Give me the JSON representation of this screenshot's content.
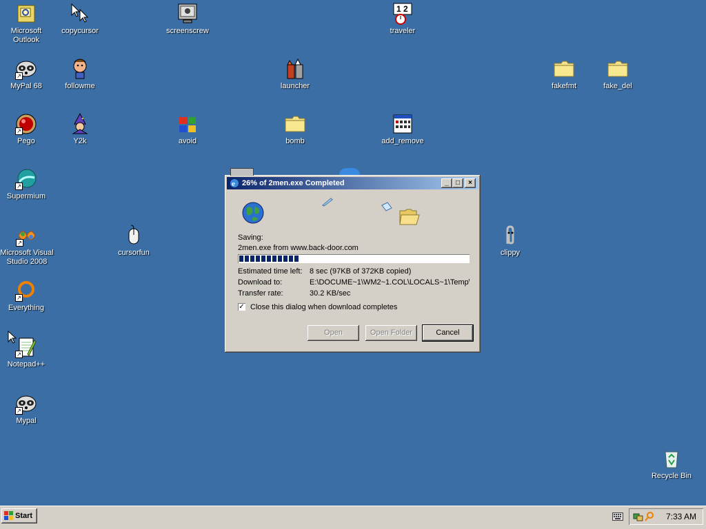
{
  "desktop": {
    "icons": [
      {
        "label": "Microsoft Outlook",
        "icon": "outlook-icon"
      },
      {
        "label": "copycursor",
        "icon": "cursor-icon"
      },
      {
        "label": "screenscrew",
        "icon": "monitor-icon"
      },
      {
        "label": "traveler",
        "icon": "clock-icon"
      },
      {
        "label": "MyPal 68",
        "icon": "raccoon-icon"
      },
      {
        "label": "followme",
        "icon": "character-icon"
      },
      {
        "label": "launcher",
        "icon": "rocket-icon"
      },
      {
        "label": "fakefmt",
        "icon": "folder-icon"
      },
      {
        "label": "fake_del",
        "icon": "folder-icon"
      },
      {
        "label": "Pego",
        "icon": "red-ball-icon"
      },
      {
        "label": "Y2k",
        "icon": "wizard-icon"
      },
      {
        "label": "avoid",
        "icon": "windows-flag-icon"
      },
      {
        "label": "bomb",
        "icon": "folder-icon"
      },
      {
        "label": "add_remove",
        "icon": "calendar-icon"
      },
      {
        "label": "Supermium",
        "icon": "supermium-icon"
      },
      {
        "label": "Microsoft Visual Studio 2008",
        "icon": "visual-studio-icon"
      },
      {
        "label": "cursorfun",
        "icon": "mouse-icon"
      },
      {
        "label": "clippy",
        "icon": "paperclip-icon"
      },
      {
        "label": "Everything",
        "icon": "search-ring-icon"
      },
      {
        "label": "Notepad++",
        "icon": "notepad-icon"
      },
      {
        "label": "Mypal",
        "icon": "raccoon-icon"
      },
      {
        "label": "Recycle Bin",
        "icon": "recycle-bin-icon"
      }
    ]
  },
  "dialog": {
    "title": "26% of 2men.exe Completed",
    "saving_label": "Saving:",
    "saving_file": "2men.exe from www.back-door.com",
    "progress": 0.26,
    "estimated_label": "Estimated time left:",
    "estimated_value": "8 sec (97KB of 372KB copied)",
    "download_to_label": "Download to:",
    "download_to_value": "E:\\DOCUME~1\\WM2~1.COL\\LOCALS~1\\Temp\\",
    "transfer_label": "Transfer rate:",
    "transfer_value": "30.2 KB/sec",
    "close_checkbox_label": "Close this dialog when download completes",
    "close_checkbox_checked": true,
    "buttons": {
      "open": "Open",
      "open_folder": "Open Folder",
      "cancel": "Cancel"
    }
  },
  "taskbar": {
    "start_label": "Start",
    "clock": "7:33 AM"
  },
  "colors": {
    "desktop": "#3a6ea5",
    "title_active": "#0a246a",
    "face": "#d4d0c8"
  }
}
